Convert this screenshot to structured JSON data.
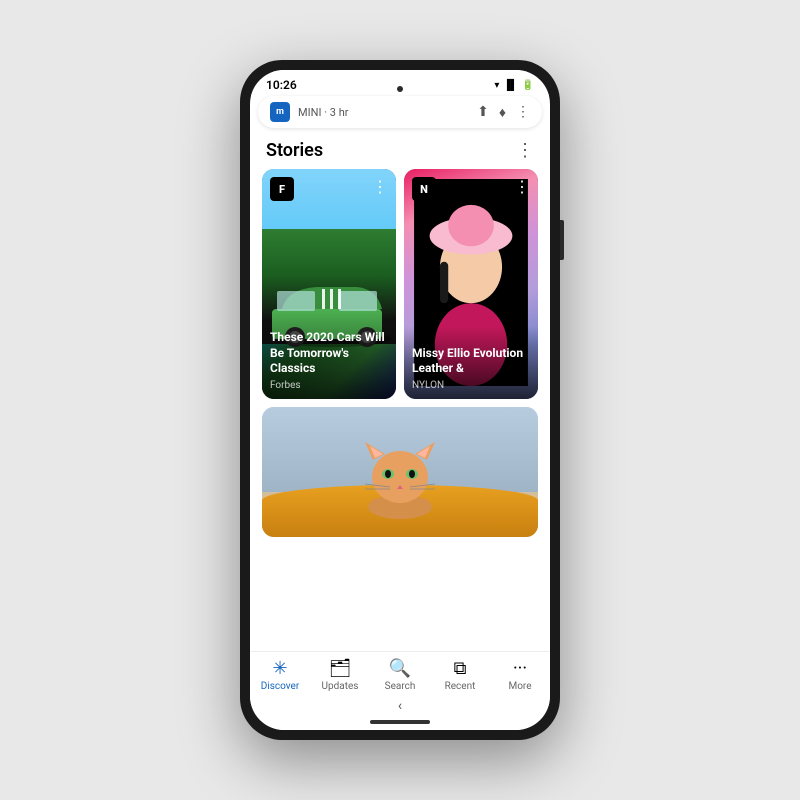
{
  "phone": {
    "status_bar": {
      "time": "10:26",
      "signal_icon": "▼▲",
      "wifi_icon": "▼",
      "battery_icon": "▐"
    },
    "notification": {
      "app_letter": "m",
      "app_name": "MINI",
      "time_ago": "3 hr",
      "share_icon": "share",
      "mic_icon": "mic",
      "menu_icon": "⋮"
    },
    "stories_section": {
      "title": "Stories",
      "menu_icon": "⋮"
    },
    "cards": [
      {
        "id": "forbes-card",
        "source_letter": "F",
        "source_name": "Forbes",
        "headline": "These 2020 Cars Will Be Tomorrow's Classics",
        "menu_icon": "⋮",
        "badge_class": "badge-forbes"
      },
      {
        "id": "nylon-card",
        "source_letter": "N",
        "source_name": "NYLON",
        "headline": "Missy Ellio Evolution Leather &",
        "menu_icon": "⋮",
        "badge_class": "badge-nylon"
      }
    ],
    "bottom_nav": [
      {
        "id": "discover",
        "label": "Discover",
        "icon": "✳",
        "active": true
      },
      {
        "id": "updates",
        "label": "Updates",
        "icon": "⊡"
      },
      {
        "id": "search",
        "label": "Search",
        "icon": "⌕"
      },
      {
        "id": "recent",
        "label": "Recent",
        "icon": "⧉"
      },
      {
        "id": "more",
        "label": "More",
        "icon": "···"
      }
    ]
  }
}
